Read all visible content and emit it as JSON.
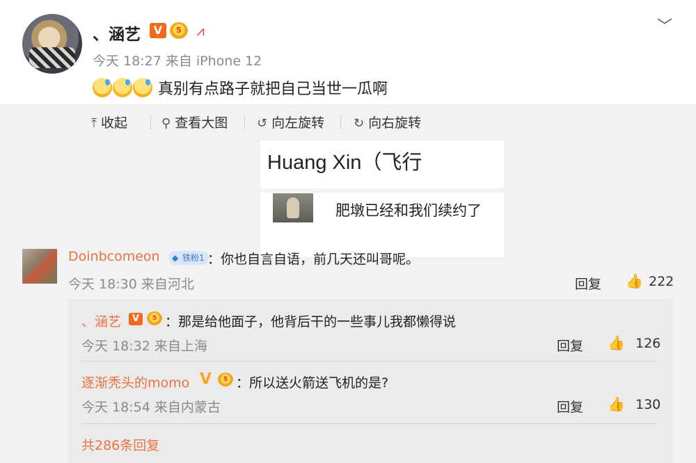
{
  "post": {
    "username": "、涵艺",
    "v_badge": "V",
    "crown_badge": "5",
    "hat_badge": "⩘",
    "time": "今天 18:27 来自 iPhone 12",
    "text": "真别有点路子就把自己当世一瓜啊",
    "collapse_icon": "chevron-down-icon"
  },
  "toolbar": {
    "collapse": "收起",
    "view_large": "查看大图",
    "rotate_left": "向左旋转",
    "rotate_right": "向右旋转"
  },
  "image": {
    "title": "Huang Xin（飞行",
    "caption": "肥墩已经和我们续约了"
  },
  "comment": {
    "username": "Doinbcomeon",
    "fan_badge": "铁粉1",
    "text": "：你也自言自语，前几天还叫哥呢。",
    "time": "今天 18:30 来自河北",
    "reply": "回复",
    "likes": "222"
  },
  "replies": [
    {
      "username": "、涵艺",
      "v_badge": "V",
      "crown_badge": "5",
      "text": "：那是给他面子，他背后干的一些事儿我都懒得说",
      "time": "今天 18:32 来自上海",
      "reply": "回复",
      "likes": "126"
    },
    {
      "username": "逐渐秃头的momo",
      "v_badge": "V",
      "crown_badge": "5",
      "text": "：所以送火箭送飞机的是?",
      "time": "今天 18:54 来自内蒙古",
      "reply": "回复",
      "likes": "130"
    }
  ],
  "more_replies": "共286条回复",
  "colors": {
    "accent": "#eb7340",
    "background": "#f2f2f2",
    "reply_bg": "#ebebeb"
  }
}
